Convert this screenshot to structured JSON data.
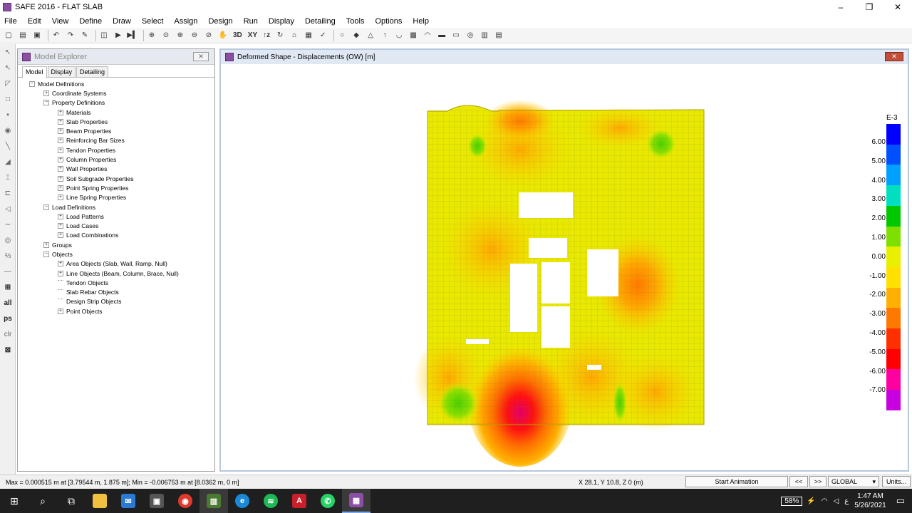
{
  "window": {
    "title": "SAFE 2016 - FLAT SLAB",
    "minimize": "–",
    "restore": "❐",
    "close": "✕"
  },
  "menu": [
    "File",
    "Edit",
    "View",
    "Define",
    "Draw",
    "Select",
    "Assign",
    "Design",
    "Run",
    "Display",
    "Detailing",
    "Tools",
    "Options",
    "Help"
  ],
  "toolbar": {
    "btn_3d": "3D",
    "btn_xy": "XY",
    "btn_z": "↑z"
  },
  "left_tools": {
    "all": "all",
    "ps": "ps",
    "clr": "clr"
  },
  "explorer": {
    "title": "Model Explorer",
    "tabs": [
      "Model",
      "Display",
      "Detailing"
    ],
    "tree": [
      {
        "label": "Model Definitions",
        "level": 0,
        "exp": "−"
      },
      {
        "label": "Coordinate Systems",
        "level": 1,
        "exp": "+"
      },
      {
        "label": "Property Definitions",
        "level": 1,
        "exp": "−"
      },
      {
        "label": "Materials",
        "level": 2,
        "exp": "+"
      },
      {
        "label": "Slab Properties",
        "level": 2,
        "exp": "+"
      },
      {
        "label": "Beam Properties",
        "level": 2,
        "exp": "+"
      },
      {
        "label": "Reinforcing Bar Sizes",
        "level": 2,
        "exp": "+"
      },
      {
        "label": "Tendon Properties",
        "level": 2,
        "exp": "+"
      },
      {
        "label": "Column Properties",
        "level": 2,
        "exp": "+"
      },
      {
        "label": "Wall Properties",
        "level": 2,
        "exp": "+"
      },
      {
        "label": "Soil Subgrade Properties",
        "level": 2,
        "exp": "+"
      },
      {
        "label": "Point Spring Properties",
        "level": 2,
        "exp": "+"
      },
      {
        "label": "Line Spring Properties",
        "level": 2,
        "exp": "+"
      },
      {
        "label": "Load Definitions",
        "level": 1,
        "exp": "−"
      },
      {
        "label": "Load Patterns",
        "level": 2,
        "exp": "+"
      },
      {
        "label": "Load Cases",
        "level": 2,
        "exp": "+"
      },
      {
        "label": "Load Combinations",
        "level": 2,
        "exp": "+"
      },
      {
        "label": "Groups",
        "level": 1,
        "exp": "+"
      },
      {
        "label": "Objects",
        "level": 1,
        "exp": "−"
      },
      {
        "label": "Area Objects (Slab, Wall, Ramp, Null)",
        "level": 2,
        "exp": "+"
      },
      {
        "label": "Line Objects (Beam, Column, Brace, Null)",
        "level": 2,
        "exp": "+"
      },
      {
        "label": "Tendon Objects",
        "level": 2,
        "exp": ""
      },
      {
        "label": "Slab Rebar Objects",
        "level": 2,
        "exp": ""
      },
      {
        "label": "Design Strip Objects",
        "level": 2,
        "exp": ""
      },
      {
        "label": "Point Objects",
        "level": 2,
        "exp": "+"
      }
    ]
  },
  "viewport": {
    "title": "Deformed Shape - Displacements (OW)  [m]"
  },
  "legend": {
    "exponent": "E-3",
    "labels": [
      "6.00",
      "5.00",
      "4.00",
      "3.00",
      "2.00",
      "1.00",
      "0.00",
      "-1.00",
      "-2.00",
      "-3.00",
      "-4.00",
      "-5.00",
      "-6.00",
      "-7.00"
    ],
    "colors": [
      "#0000ff",
      "#0050ff",
      "#00a0ff",
      "#00e0c0",
      "#00c800",
      "#7ee000",
      "#e8f000",
      "#ffe000",
      "#ffb000",
      "#ff7800",
      "#ff3000",
      "#ff0000",
      "#ff00a0",
      "#c800e0"
    ]
  },
  "status": {
    "minmax": "Max = 0.000515 m at [3.79544 m, 1.875 m];  Min = -0.006753 m at [8.0362 m, 0 m]",
    "coords": "X 28.1,  Y 10.8,  Z 0  (m)",
    "animate": "Start Animation",
    "prev": "<<",
    "next": ">>",
    "coord_system": "GLOBAL",
    "units": "Units..."
  },
  "taskbar": {
    "battery": "58%",
    "lang": "ع",
    "time": "1:47 AM",
    "date": "5/26/2021"
  }
}
